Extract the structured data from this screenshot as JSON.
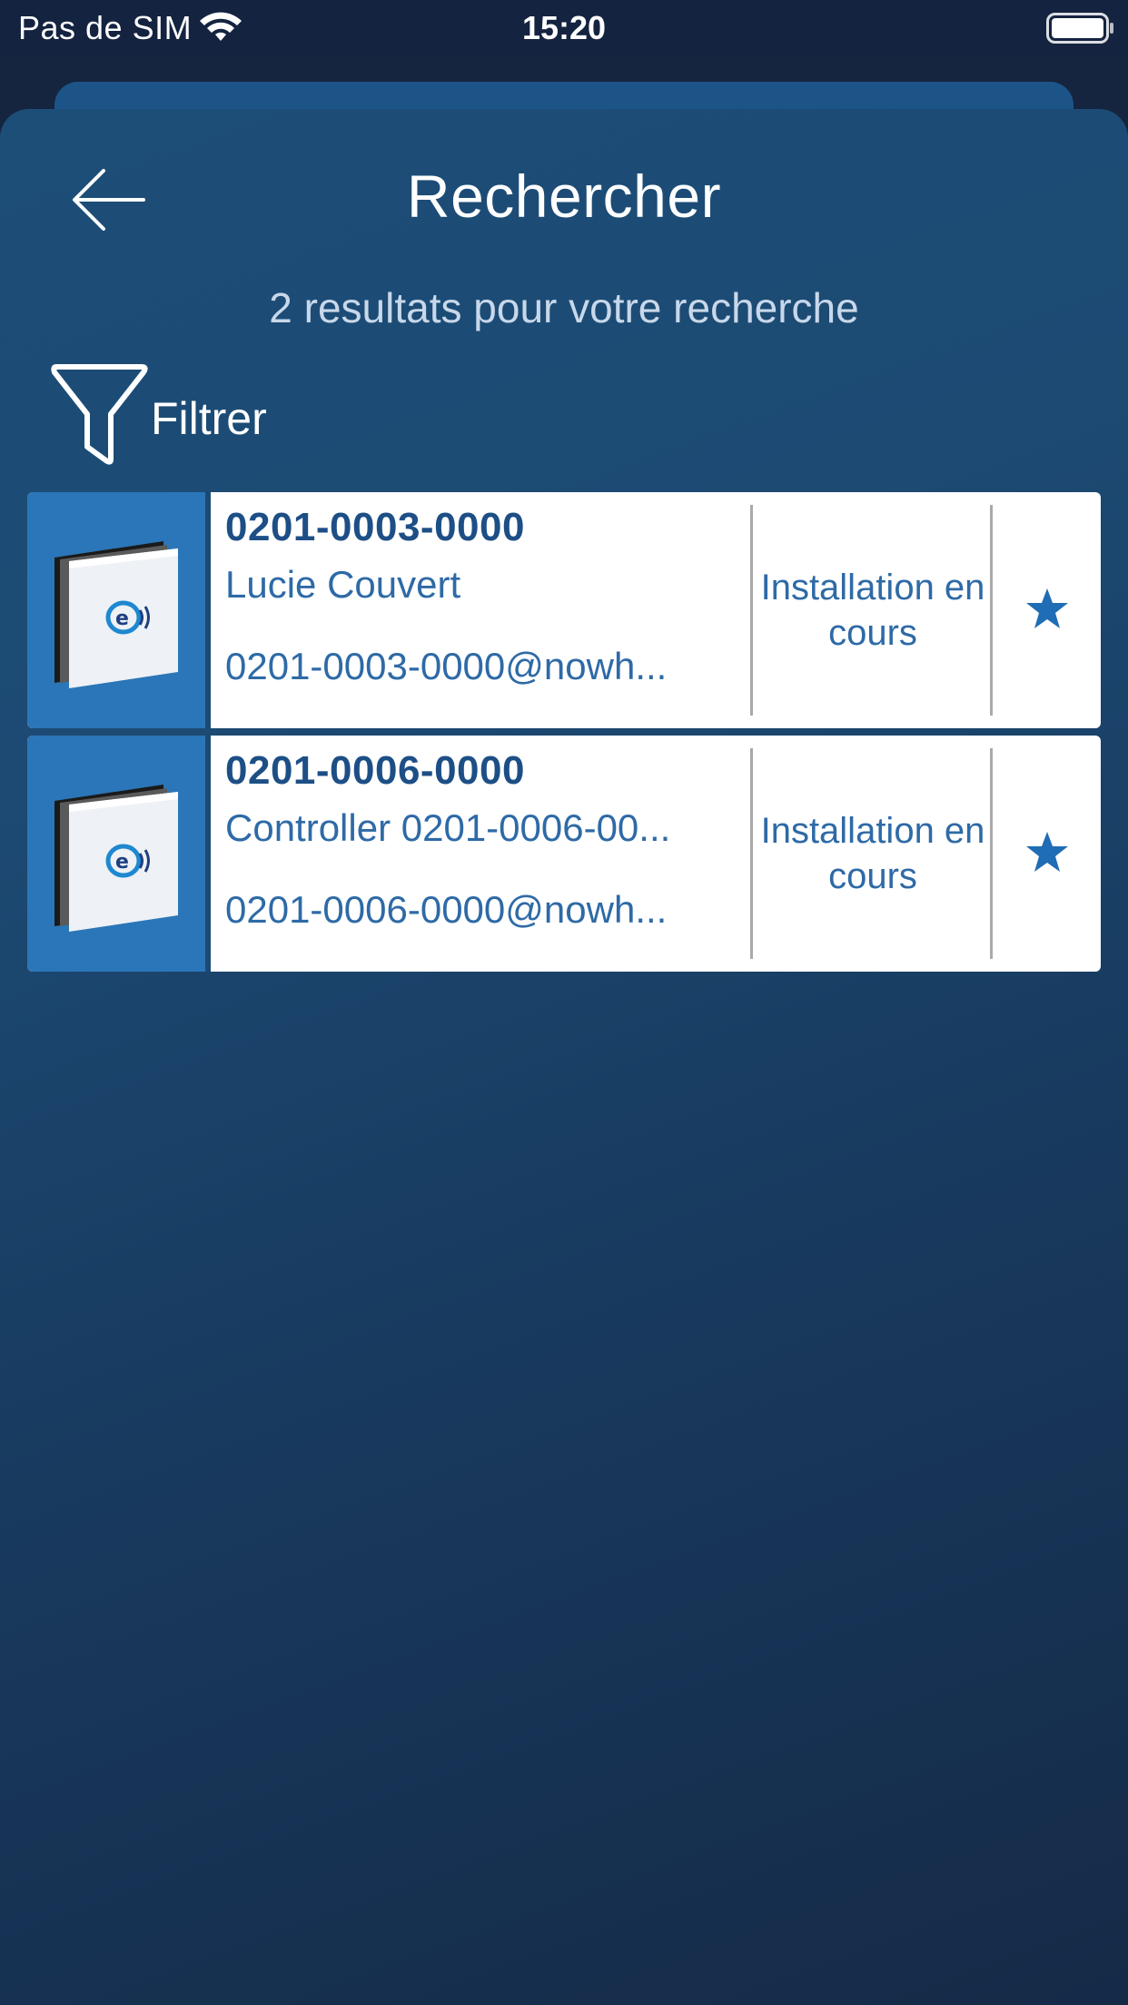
{
  "status_bar": {
    "carrier": "Pas de SIM",
    "time": "15:20",
    "wifi_icon": "wifi-icon",
    "battery_icon": "battery-icon"
  },
  "header": {
    "back_icon": "arrow-left-icon",
    "title": "Rechercher"
  },
  "results_summary": "2 resultats pour votre recherche",
  "filter": {
    "icon": "funnel-icon",
    "label": "Filtrer"
  },
  "results": [
    {
      "id": "0201-0003-0000",
      "name": "Lucie Couvert",
      "email": "0201-0003-0000@nowh...",
      "status": "Installation en cours",
      "favorite_icon": "star-icon"
    },
    {
      "id": "0201-0006-0000",
      "name": "Controller 0201-0006-00...",
      "email": "0201-0006-0000@nowh...",
      "status": "Installation en cours",
      "favorite_icon": "star-icon"
    }
  ],
  "colors": {
    "accent": "#2a76b8",
    "title_text": "#1d4f86",
    "body_text": "#2e6aa6",
    "background_top": "#1d4e78",
    "background_bottom": "#152a47"
  }
}
